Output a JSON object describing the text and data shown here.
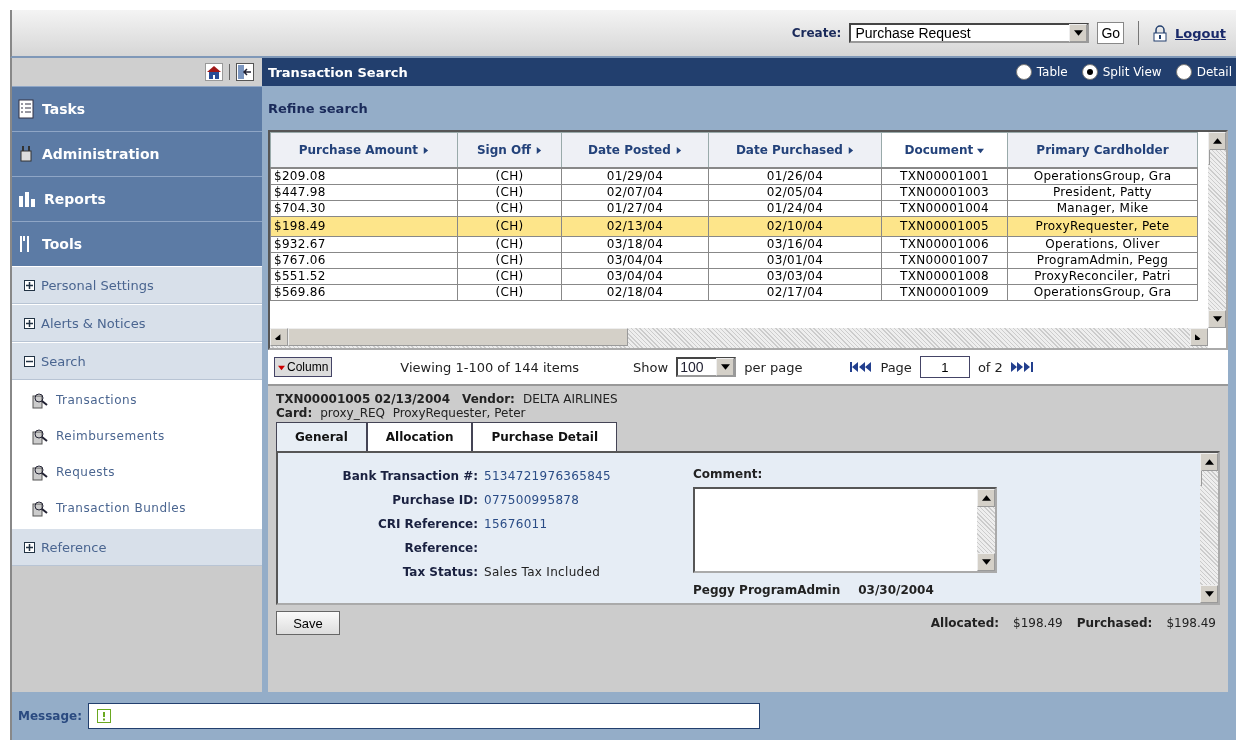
{
  "top_bar": {
    "create_label": "Create:",
    "create_select": "Purchase Request",
    "go_button": "Go",
    "logout": "Logout"
  },
  "sidebar": {
    "sections": [
      {
        "label": "Tasks"
      },
      {
        "label": "Administration"
      },
      {
        "label": "Reports"
      },
      {
        "label": "Tools"
      }
    ],
    "items": [
      {
        "label": "Personal Settings",
        "expanded": false
      },
      {
        "label": "Alerts & Notices",
        "expanded": false
      },
      {
        "label": "Search",
        "expanded": true,
        "children": [
          {
            "label": "Transactions"
          },
          {
            "label": "Reimbursements"
          },
          {
            "label": "Requests"
          },
          {
            "label": "Transaction Bundles"
          }
        ]
      },
      {
        "label": "Reference",
        "expanded": false
      }
    ]
  },
  "header": {
    "title": "Transaction Search",
    "views": [
      {
        "label": "Table",
        "selected": false
      },
      {
        "label": "Split View",
        "selected": true
      },
      {
        "label": "Detail",
        "selected": false
      }
    ]
  },
  "refine": "Refine search",
  "table": {
    "columns": [
      {
        "label": "Purchase Amount",
        "sorted": false
      },
      {
        "label": "Sign Off",
        "sorted": false
      },
      {
        "label": "Date Posted",
        "sorted": false
      },
      {
        "label": "Date Purchased",
        "sorted": false
      },
      {
        "label": "Document",
        "sorted": true
      },
      {
        "label": "Primary Cardholder",
        "sorted": false
      }
    ],
    "rows": [
      {
        "selected": false,
        "cells": [
          "$209.08",
          "(CH)",
          "01/29/04",
          "01/26/04",
          "TXN00001001",
          "OperationsGroup, Gra"
        ]
      },
      {
        "selected": false,
        "cells": [
          "$447.98",
          "(CH)",
          "02/07/04",
          "02/05/04",
          "TXN00001003",
          "President, Patty"
        ]
      },
      {
        "selected": false,
        "cells": [
          "$704.30",
          "(CH)",
          "01/27/04",
          "01/24/04",
          "TXN00001004",
          "Manager, Mike"
        ]
      },
      {
        "selected": true,
        "cells": [
          "$198.49",
          "(CH)",
          "02/13/04",
          "02/10/04",
          "TXN00001005",
          "ProxyRequester, Pete"
        ]
      },
      {
        "selected": false,
        "cells": [
          "$932.67",
          "(CH)",
          "03/18/04",
          "03/16/04",
          "TXN00001006",
          "Operations, Oliver"
        ]
      },
      {
        "selected": false,
        "cells": [
          "$767.06",
          "(CH)",
          "03/04/04",
          "03/01/04",
          "TXN00001007",
          "ProgramAdmin, Pegg"
        ]
      },
      {
        "selected": false,
        "cells": [
          "$551.52",
          "(CH)",
          "03/04/04",
          "03/03/04",
          "TXN00001008",
          "ProxyReconciler, Patri"
        ]
      },
      {
        "selected": false,
        "cells": [
          "$569.86",
          "(CH)",
          "02/18/04",
          "02/17/04",
          "TXN00001009",
          "OperationsGroup, Gra"
        ]
      }
    ]
  },
  "pager": {
    "column_button": "Column",
    "viewing": "Viewing 1-100 of 144 items",
    "show": "Show",
    "per_page_value": "100",
    "per_page": "per page",
    "page_label": "Page",
    "page_value": "1",
    "of": "of 2"
  },
  "detail": {
    "heading": "TXN00001005 02/13/2004",
    "vendor_label": "Vendor:",
    "vendor": "DELTA AIRLINES",
    "card_label": "Card:",
    "card": "proxy_REQ  ProxyRequester, Peter",
    "tabs": [
      {
        "label": "General",
        "selected": true
      },
      {
        "label": "Allocation",
        "selected": false
      },
      {
        "label": "Purchase Detail",
        "selected": false
      }
    ],
    "fields": [
      {
        "label": "Bank Transaction #:",
        "value": "5134721976365845",
        "kind": "link"
      },
      {
        "label": "Purchase ID:",
        "value": "077500995878",
        "kind": "link"
      },
      {
        "label": "CRI Reference:",
        "value": "15676011",
        "kind": "link"
      },
      {
        "label": "Reference:"
      },
      {
        "label": "Tax Status:",
        "value": "Sales Tax Included",
        "kind": "plain"
      }
    ],
    "comment_label": "Comment:",
    "comment_author": "Peggy ProgramAdmin",
    "comment_date": "03/30/2004",
    "save": "Save",
    "allocated_label": "Allocated:",
    "allocated": "$198.49",
    "purchased_label": "Purchased:",
    "purchased": "$198.49"
  },
  "message": {
    "label": "Message:"
  }
}
